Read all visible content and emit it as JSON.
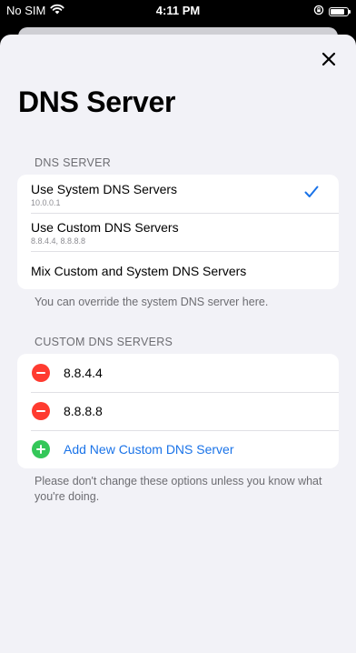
{
  "status_bar": {
    "carrier": "No SIM",
    "time": "4:11 PM"
  },
  "page": {
    "title": "DNS Server"
  },
  "dns_server_section": {
    "header": "DNS SERVER",
    "options": [
      {
        "label": "Use System DNS Servers",
        "detail": "10.0.0.1",
        "selected": true
      },
      {
        "label": "Use Custom DNS Servers",
        "detail": "8.8.4.4, 8.8.8.8",
        "selected": false
      },
      {
        "label": "Mix Custom and System DNS Servers",
        "detail": "",
        "selected": false
      }
    ],
    "footer": "You can override the system DNS server here."
  },
  "custom_section": {
    "header": "CUSTOM DNS SERVERS",
    "servers": [
      "8.8.4.4",
      "8.8.8.8"
    ],
    "add_label": "Add New Custom DNS Server",
    "footer": "Please don't change these options unless you know what you're doing."
  },
  "icons": {
    "close": "close-icon",
    "checkmark": "checkmark-icon",
    "remove": "remove-circle-icon",
    "add": "add-circle-icon",
    "wifi": "wifi-icon",
    "battery": "battery-icon",
    "rotation_lock": "rotation-lock-icon"
  },
  "colors": {
    "accent": "#1a73e8",
    "destructive": "#ff3b30",
    "add": "#34c759",
    "background": "#f2f2f7"
  }
}
